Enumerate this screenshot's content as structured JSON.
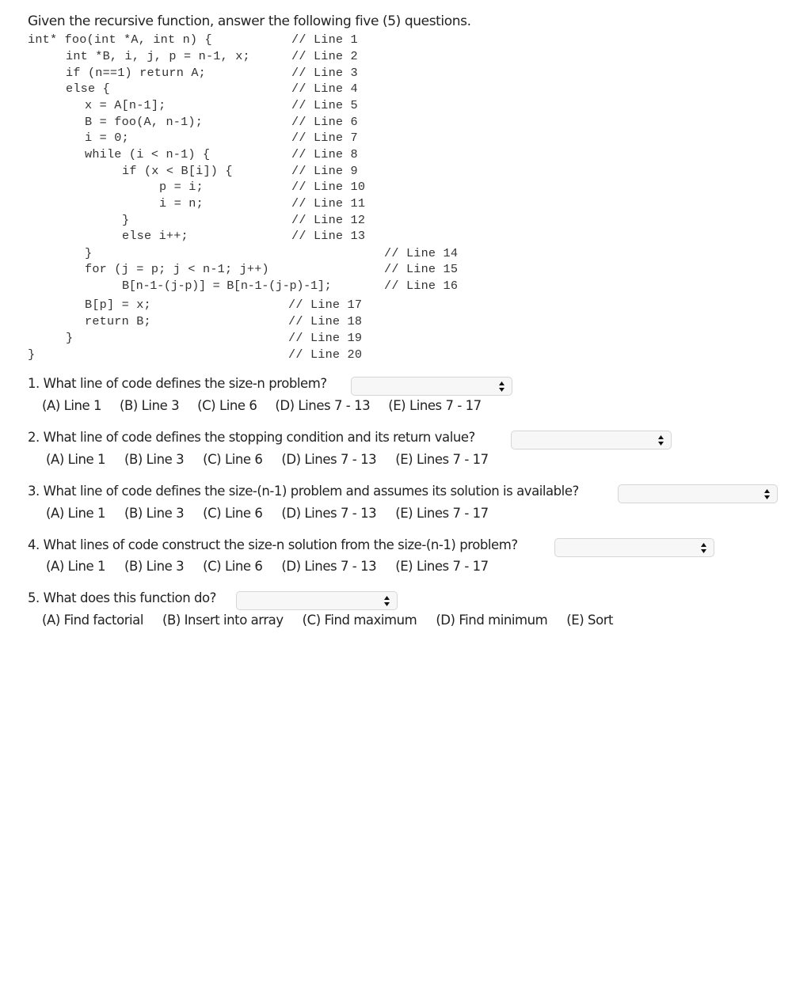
{
  "intro": "Given the recursive function, answer the following five (5) questions.",
  "code": [
    {
      "code": "int* foo(int *A, int n) {",
      "comment": "// Line 1"
    },
    {
      "code": "int *B, i, j, p = n-1, x;",
      "comment": "// Line 2"
    },
    {
      "code": "if (n==1) return A;",
      "comment": "// Line 3"
    },
    {
      "code": "else {",
      "comment": "// Line 4"
    },
    {
      "code": "x = A[n-1];",
      "comment": "// Line 5"
    },
    {
      "code": "B = foo(A, n-1);",
      "comment": "// Line 6"
    },
    {
      "code": "i = 0;",
      "comment": "// Line 7"
    },
    {
      "code": "while (i < n-1) {",
      "comment": "// Line 8"
    },
    {
      "code": "if (x < B[i]) {",
      "comment": "// Line 9"
    },
    {
      "code": "p = i;",
      "comment": "// Line 10"
    },
    {
      "code": "i = n;",
      "comment": "// Line 11"
    },
    {
      "code": "}",
      "comment": "// Line 12"
    },
    {
      "code": "else i++;",
      "comment": "// Line 13"
    },
    {
      "code": "}",
      "comment": "// Line 14"
    },
    {
      "code": "for (j = p; j < n-1; j++)",
      "comment": "// Line 15"
    },
    {
      "code": "B[n-1-(j-p)] = B[n-1-(j-p)-1];",
      "comment": "// Line 16"
    },
    {
      "code": "B[p] = x;",
      "comment": "// Line 17"
    },
    {
      "code": "return B;",
      "comment": "// Line 18"
    },
    {
      "code": "}",
      "comment": "// Line 19"
    },
    {
      "code": "}",
      "comment": "// Line 20"
    }
  ],
  "questions": [
    {
      "text": "1. What line of code defines the size-n problem?",
      "selected": "",
      "options": [
        "(A) Line 1",
        "(B) Line 3",
        "(C) Line 6",
        "(D) Lines 7 - 13",
        "(E) Lines 7 - 17"
      ]
    },
    {
      "text": "2. What line of code defines the stopping condition and its return value?",
      "selected": "",
      "options": [
        "(A) Line 1",
        "(B) Line 3",
        "(C) Line 6",
        "(D) Lines 7 - 13",
        "(E) Lines 7 - 17"
      ]
    },
    {
      "text": "3. What line of code defines the size-(n-1) problem and assumes its solution is available?",
      "selected": "",
      "options": [
        "(A) Line 1",
        "(B) Line 3",
        "(C) Line 6",
        "(D) Lines 7 - 13",
        "(E) Lines 7 - 17"
      ]
    },
    {
      "text": "4. What lines of code construct the size-n solution from the size-(n-1) problem?",
      "selected": "",
      "options": [
        "(A) Line 1",
        "(B) Line 3",
        "(C) Line 6",
        "(D) Lines 7 - 13",
        "(E) Lines 7 - 17"
      ]
    },
    {
      "text": "5. What does this function do?",
      "selected": "",
      "options": [
        "(A) Find factorial",
        "(B) Insert into array",
        "(C) Find maximum",
        "(D) Find minimum",
        "(E) Sort"
      ]
    }
  ],
  "icons": {
    "select_arrow": "up-down-chevron-icon"
  }
}
